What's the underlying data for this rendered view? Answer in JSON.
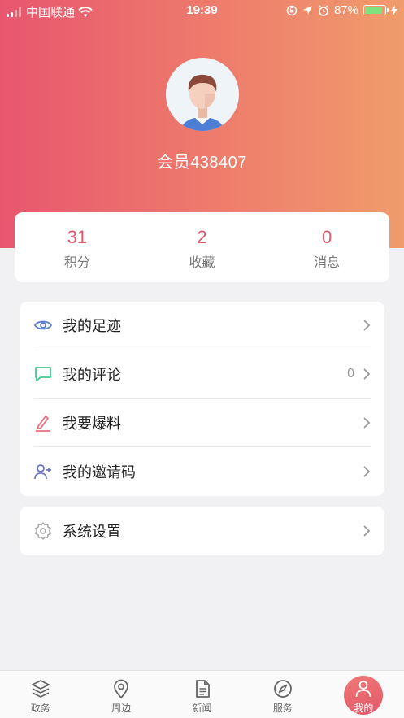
{
  "status_bar": {
    "carrier": "中国联通",
    "time": "19:39",
    "battery": "87%",
    "battery_level": 0.87
  },
  "profile": {
    "username": "会员438407"
  },
  "stats": [
    {
      "value": "31",
      "label": "积分"
    },
    {
      "value": "2",
      "label": "收藏"
    },
    {
      "value": "0",
      "label": "消息"
    }
  ],
  "menu": [
    {
      "label": "我的足迹",
      "icon": "eye-icon",
      "count": ""
    },
    {
      "label": "我的评论",
      "icon": "comment-icon",
      "count": "0"
    },
    {
      "label": "我要爆料",
      "icon": "pencil-icon",
      "count": ""
    },
    {
      "label": "我的邀请码",
      "icon": "add-user-icon",
      "count": ""
    }
  ],
  "settings": {
    "label": "系统设置",
    "icon": "gear-icon"
  },
  "tabs": [
    {
      "label": "政务",
      "icon": "layers-icon",
      "active": false
    },
    {
      "label": "周边",
      "icon": "location-pin-icon",
      "active": false
    },
    {
      "label": "新闻",
      "icon": "document-icon",
      "active": false
    },
    {
      "label": "服务",
      "icon": "compass-icon",
      "active": false
    },
    {
      "label": "我的",
      "icon": "user-icon",
      "active": true
    }
  ],
  "colors": {
    "header_start": "#e8566e",
    "header_end": "#f09c6c",
    "accent": "#e0566b"
  }
}
